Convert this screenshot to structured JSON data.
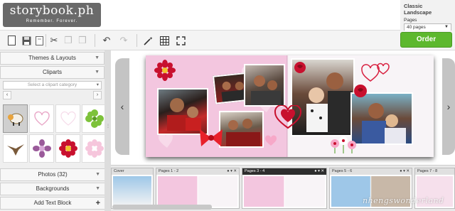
{
  "header": {
    "logo_text": "storybook.ph",
    "logo_tagline": "Remember. Forever.",
    "product_title": "Classic Landscape",
    "pages_label": "Pages",
    "pages_value": "40 pages",
    "order_label": "Order"
  },
  "toolbar": {
    "icons": [
      "new-page-icon",
      "save-icon",
      "delete-page-icon",
      "cut-icon",
      "copy-icon",
      "paste-icon",
      "undo-icon",
      "redo-icon",
      "magic-wand-icon",
      "grid-icon",
      "fullscreen-icon"
    ]
  },
  "left_panel": {
    "themes_label": "Themes & Layouts",
    "cliparts_label": "Cliparts",
    "category_placeholder": "Select a clipart category",
    "prev": "‹",
    "next": "›",
    "cliparts": [
      "sheep",
      "heart-outline",
      "heart-outline-pale",
      "green-flower",
      "eagle",
      "purple-flower",
      "red-flower",
      "pink-flower"
    ],
    "photos_label": "Photos (32)",
    "backgrounds_label": "Backgrounds",
    "add_text_label": "Add Text Block",
    "add_text_icon": "+"
  },
  "canvas": {
    "nav_prev": "‹",
    "nav_next": "›"
  },
  "pages_strip": {
    "thumbs": [
      {
        "label": "Cover"
      },
      {
        "label": "Pages 1 - 2"
      },
      {
        "label": "Pages 3 - 4"
      },
      {
        "label": "Pages 5 - 6"
      },
      {
        "label": "Pages 7 - 8"
      }
    ]
  },
  "watermark": "nhengswonderland",
  "colors": {
    "order_green": "#5db82e",
    "logo_gray": "#6a6a6a",
    "page_pink": "#f3c6df",
    "active_thumb": "#2e2e2e"
  }
}
